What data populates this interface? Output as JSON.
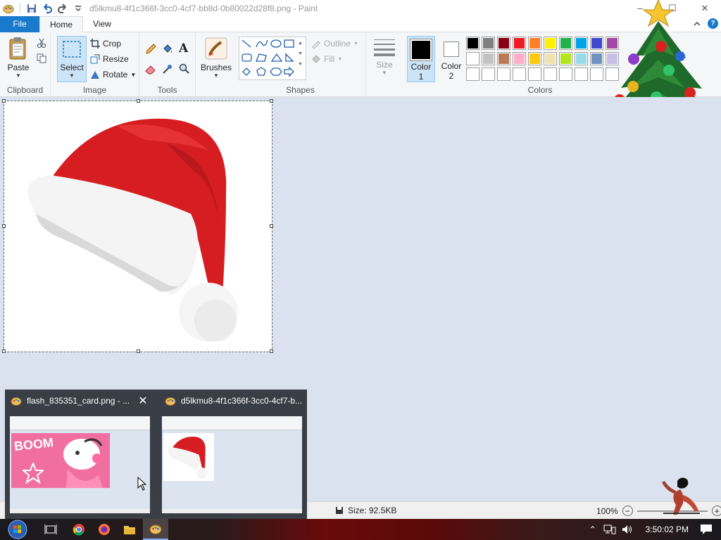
{
  "window": {
    "title": "d5lkmu8-4f1c366f-3cc0-4cf7-bb8d-0b80022d28f8.png - Paint"
  },
  "tabs": {
    "file": "File",
    "home": "Home",
    "view": "View"
  },
  "ribbon": {
    "clipboard": {
      "label": "Clipboard",
      "paste": "Paste"
    },
    "image": {
      "label": "Image",
      "select": "Select",
      "crop": "Crop",
      "resize": "Resize",
      "rotate": "Rotate"
    },
    "tools": {
      "label": "Tools"
    },
    "brushes": {
      "label": "Brushes"
    },
    "shapes": {
      "label": "Shapes",
      "outline": "Outline",
      "fill": "Fill"
    },
    "size": {
      "label": "Size"
    },
    "color1": {
      "label": "Color",
      "num": "1"
    },
    "color2": {
      "label": "Color",
      "num": "2"
    },
    "colors": {
      "label": "Colors"
    }
  },
  "palette": {
    "row1": [
      "#000000",
      "#7f7f7f",
      "#880015",
      "#ed1c24",
      "#ff7f27",
      "#fff200",
      "#22b14c",
      "#00a2e8",
      "#3f48cc",
      "#a349a4"
    ],
    "row2": [
      "#ffffff",
      "#c3c3c3",
      "#b97a57",
      "#ffaec9",
      "#ffc90e",
      "#efe4b0",
      "#b5e61d",
      "#99d9ea",
      "#7092be",
      "#c8bfe7"
    ],
    "row3": [
      "#ffffff",
      "#ffffff",
      "#ffffff",
      "#ffffff",
      "#ffffff",
      "#ffffff",
      "#ffffff",
      "#ffffff",
      "#ffffff",
      "#ffffff"
    ]
  },
  "status": {
    "size": "Size: 92.5KB",
    "zoom": "100%"
  },
  "thumbnails": [
    {
      "title": "flash_835351_card.png - ...",
      "preview_text": "BOOM"
    },
    {
      "title": "d5lkmu8-4f1c366f-3cc0-4cf7-b..."
    }
  ],
  "taskbar": {
    "clock": "3:50:02 PM"
  },
  "colors": {
    "file_tab": "#1979ca",
    "accent": "#1979ca",
    "hat_red": "#d61e22"
  }
}
